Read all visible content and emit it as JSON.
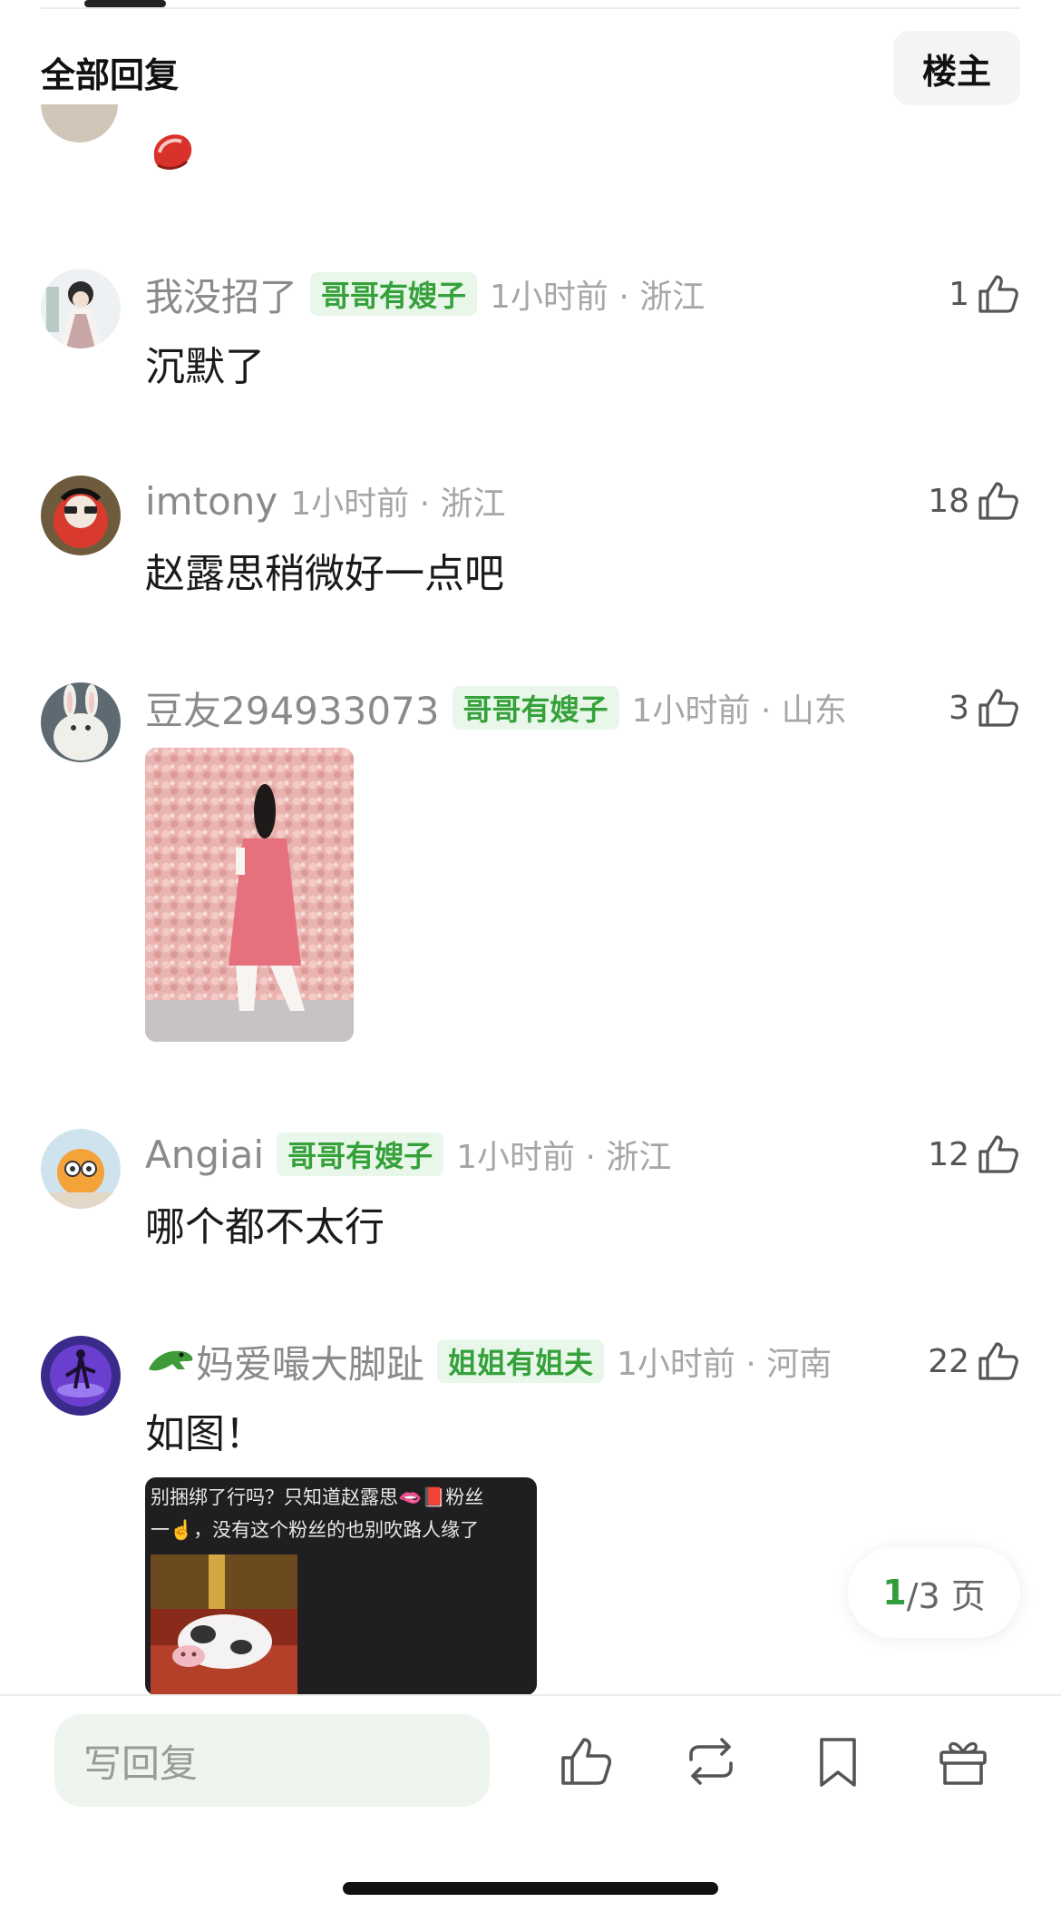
{
  "header": {
    "title": "全部回复",
    "owner_button": "楼主"
  },
  "comments": [
    {
      "name": "我没招了",
      "badge": "哥哥有嫂子",
      "time": "1小时前 · 浙江",
      "likes": "1",
      "text": "沉默了"
    },
    {
      "name": "imtony",
      "badge": "",
      "time": "1小时前 · 浙江",
      "likes": "18",
      "text": "赵露思稍微好一点吧"
    },
    {
      "name": "豆友294933073",
      "badge": "哥哥有嫂子",
      "time": "1小时前 · 山东",
      "likes": "3",
      "text": ""
    },
    {
      "name": "Angiai",
      "badge": "哥哥有嫂子",
      "time": "1小时前 · 浙江",
      "likes": "12",
      "text": "哪个都不太行"
    },
    {
      "name": "妈爱嘬大脚趾",
      "badge": "姐姐有姐夫",
      "time": "1小时前 · 河南",
      "likes": "22",
      "text": "如图！"
    }
  ],
  "screenshot_image": {
    "line1": "别捆绑了行吗？只知道赵露思🫦📕粉丝",
    "line2": "一☝️，没有这个粉丝的也别吹路人缘了"
  },
  "pager": {
    "current": "1",
    "rest": "/3 页"
  },
  "bottom_bar": {
    "reply_placeholder": "写回复"
  },
  "colors": {
    "badge_text": "#35a13a",
    "badge_bg": "#e9f7ea",
    "pager_current": "#2f9e3b",
    "reply_bg": "#eef5ee"
  }
}
